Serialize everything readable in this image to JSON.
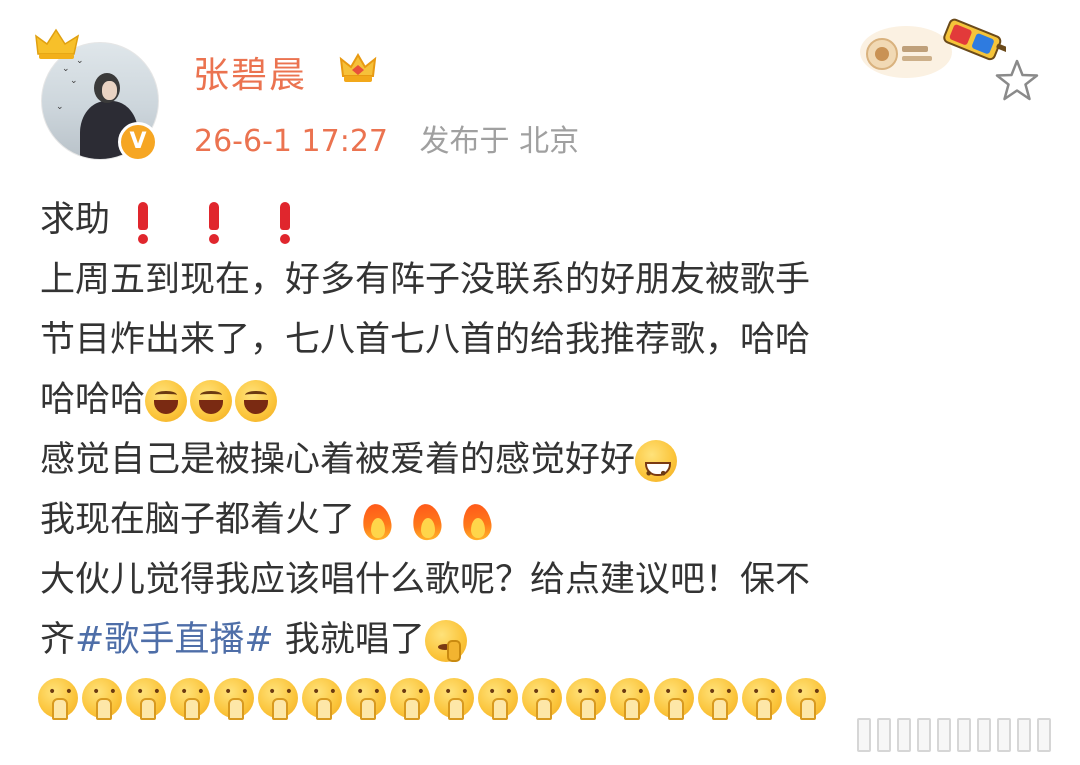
{
  "post": {
    "username": "张碧晨",
    "timestamp": "26-6-1 17:27",
    "location": "发布于 北京",
    "icons": {
      "avatar_crown": "crown-icon",
      "verified": "verified-v-badge-icon",
      "member": "member-crown-icon",
      "decoration": "3d-glasses-badge-icon",
      "favorite": "star-icon"
    },
    "colors": {
      "username": "#eb7350",
      "topic_link": "#4e6ea8",
      "text": "#333333",
      "meta": "#a0a0a0"
    },
    "verified_letter": "V",
    "content": {
      "line1": "求助",
      "line2": "上周五到现在，好多有阵子没联系的好朋友被歌手",
      "line3": "节目炸出来了，七八首七八首的给我推荐歌，哈哈",
      "line4": "哈哈哈",
      "line5": "感觉自己是被操心着被爱着的感觉好好",
      "line6": "我现在脑子都着火了",
      "line7": "大伙儿觉得我应该唱什么歌呢？给点建议吧！保不",
      "line8_prefix": "齐",
      "topic": "#歌手直播#",
      "line8_suffix": " 我就唱了"
    },
    "emoji_counts": {
      "exclamation": 3,
      "laugh": 3,
      "flame": 3,
      "pray": 18
    }
  }
}
